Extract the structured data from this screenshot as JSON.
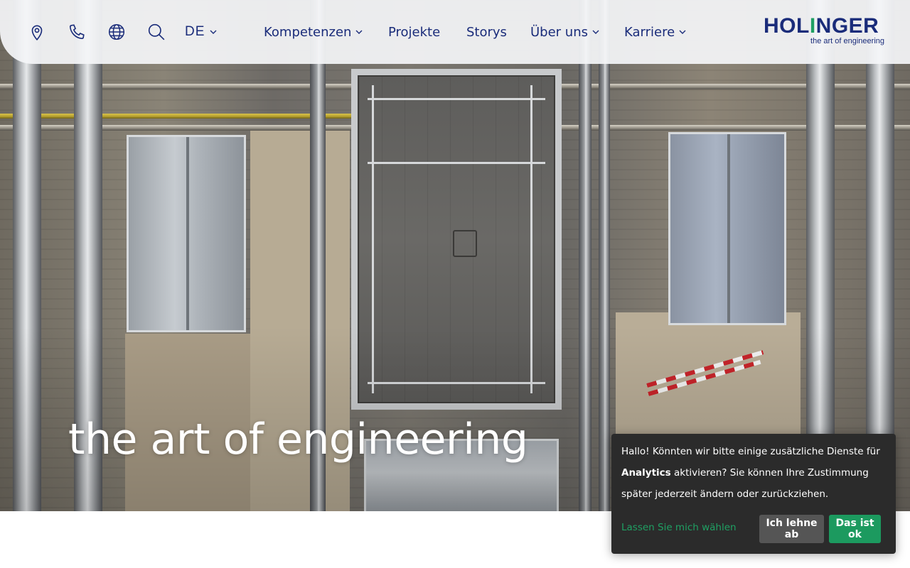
{
  "header": {
    "language": "DE",
    "nav": [
      {
        "label": "Kompetenzen",
        "has_dropdown": true
      },
      {
        "label": "Projekte",
        "has_dropdown": false
      },
      {
        "label": "Storys",
        "has_dropdown": false
      },
      {
        "label": "Über uns",
        "has_dropdown": true
      },
      {
        "label": "Karriere",
        "has_dropdown": true
      }
    ],
    "icons": [
      "location-pin-icon",
      "phone-icon",
      "globe-icon",
      "search-icon"
    ],
    "logo": {
      "part1": "HOL",
      "accent": "I",
      "part2": "NGER",
      "tagline": "the art of engineering"
    }
  },
  "hero": {
    "title": "the art of engineering"
  },
  "cookie": {
    "text_before": "Hallo! Könnten wir bitte einige zusätzliche Dienste für ",
    "text_bold": "Analytics",
    "text_after": " aktivieren? Sie können Ihre Zustimmung später jederzeit ändern oder zurückziehen.",
    "choose_label": "Lassen Sie mich wählen",
    "decline_label": "Ich lehne ab",
    "accept_label": "Das ist ok"
  },
  "colors": {
    "brand_blue": "#1a2c7a",
    "brand_green": "#1fa063",
    "cookie_bg": "#2b2b2b",
    "decline_bg": "#555555",
    "accept_bg": "#1c9a5f"
  }
}
